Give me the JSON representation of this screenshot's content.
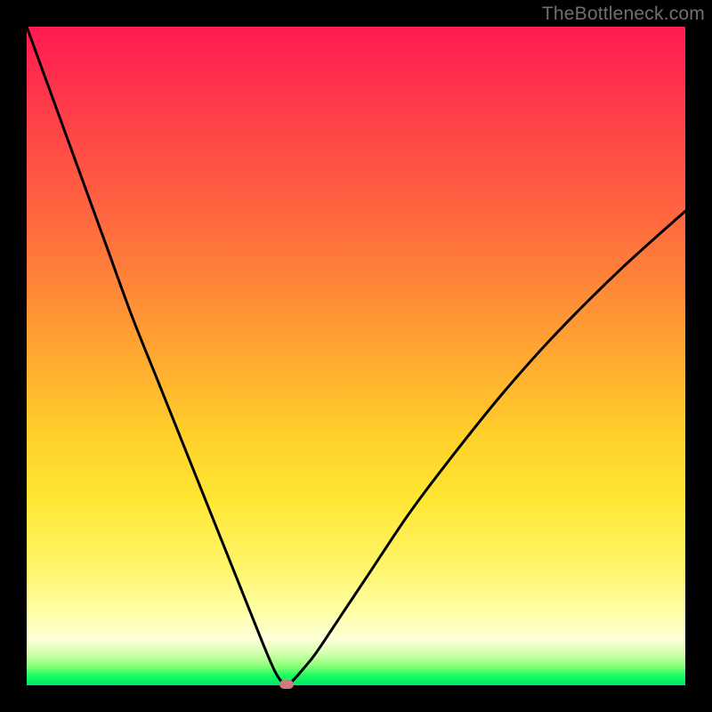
{
  "attribution": "TheBottleneck.com",
  "chart_data": {
    "type": "line",
    "title": "",
    "xlabel": "",
    "ylabel": "",
    "xlim": [
      0,
      100
    ],
    "ylim": [
      0,
      100
    ],
    "grid": false,
    "legend": false,
    "background_gradient": {
      "direction": "top-to-bottom",
      "stops": [
        {
          "pos": 0,
          "color": "#ff1a52"
        },
        {
          "pos": 30,
          "color": "#ff6a3e"
        },
        {
          "pos": 62,
          "color": "#ffd02a"
        },
        {
          "pos": 89,
          "color": "#ffffa8"
        },
        {
          "pos": 97,
          "color": "#8fff7a"
        },
        {
          "pos": 100,
          "color": "#00e66b"
        }
      ]
    },
    "curve_color": "#000000",
    "curve_width": 3,
    "series": [
      {
        "name": "bottleneck-curve",
        "x": [
          0,
          4,
          8,
          12,
          16,
          20,
          24,
          28,
          32,
          34,
          36,
          37.5,
          38.5,
          39.5,
          40.5,
          42,
          44,
          48,
          52,
          58,
          64,
          72,
          80,
          90,
          100
        ],
        "y": [
          100,
          89,
          78,
          67,
          56,
          46,
          36,
          26,
          16,
          11,
          6,
          2.5,
          0.8,
          0,
          0.8,
          2.5,
          5,
          11,
          17,
          26,
          34,
          44,
          53,
          63,
          72
        ]
      }
    ],
    "marker": {
      "name": "optimal-point",
      "x": 39.5,
      "y": 0,
      "color": "#cc7a7a"
    }
  }
}
